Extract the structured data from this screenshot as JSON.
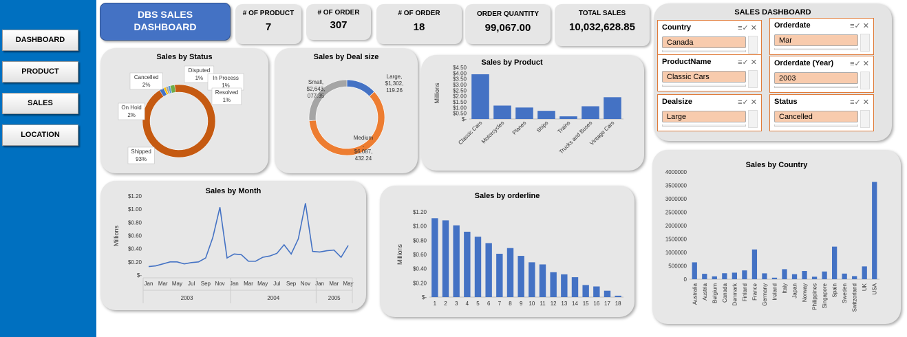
{
  "sidebar": {
    "buttons": [
      {
        "label": "DASHBOARD"
      },
      {
        "label": "PRODUCT"
      },
      {
        "label": "SALES"
      },
      {
        "label": "LOCATION"
      }
    ]
  },
  "header": {
    "title_line1": "DBS SALES",
    "title_line2": "DASHBOARD"
  },
  "kpis": [
    {
      "label": "# OF PRODUCT",
      "value": "7"
    },
    {
      "label": "# OF ORDER",
      "value": "307"
    },
    {
      "label": "# OF ORDER",
      "value": "18"
    },
    {
      "label": "ORDER QUANTITY",
      "value": "99,067.00"
    },
    {
      "label": "TOTAL SALES",
      "value": "10,032,628.85"
    }
  ],
  "filters": {
    "title": "SALES DASHBOARD",
    "slicers": [
      {
        "header": "Country",
        "value": "Canada"
      },
      {
        "header": "Orderdate",
        "value": "Mar"
      },
      {
        "header": "ProductName",
        "value": "Classic Cars"
      },
      {
        "header": "Orderdate (Year)",
        "value": "2003"
      },
      {
        "header": "Dealsize",
        "value": "Large"
      },
      {
        "header": "Status",
        "value": "Cancelled"
      }
    ]
  },
  "colors": {
    "accent_blue": "#4472c4",
    "sidebar": "#0070c0",
    "status_ring": "#c55a11",
    "deal_medium": "#ed7d31",
    "deal_small": "#a5a5a5",
    "slicer_selected": "#f8cbad",
    "slicer_border": "#e07b39"
  },
  "chart_data": [
    {
      "type": "pie",
      "title": "Sales by Status",
      "donut": true,
      "labels": [
        "Shipped",
        "Cancelled",
        "Disputed",
        "In Process",
        "Resolved",
        "On Hold"
      ],
      "values": [
        93,
        2,
        1,
        1,
        1,
        2
      ],
      "data_labels": [
        {
          "name": "Cancelled",
          "pct": "2%"
        },
        {
          "name": "Disputed",
          "pct": "1%"
        },
        {
          "name": "In Process",
          "pct": "1%"
        },
        {
          "name": "Resolved",
          "pct": "1%"
        },
        {
          "name": "On Hold",
          "pct": "2%"
        },
        {
          "name": "Shipped",
          "pct": "93%"
        }
      ]
    },
    {
      "type": "pie",
      "title": "Sales by Deal size",
      "donut": true,
      "labels": [
        "Large",
        "Medium",
        "Small"
      ],
      "values": [
        1302119.26,
        6087432.24,
        2643077.35
      ],
      "data_labels": [
        {
          "name": "Large",
          "value": "$1,302, 119.26"
        },
        {
          "name": "Medium",
          "value": "$6,087, 432.24"
        },
        {
          "name": "Small",
          "value": "$2,643, 077.35"
        }
      ]
    },
    {
      "type": "bar",
      "title": "Sales by Product",
      "ylabel": "Millions",
      "categories": [
        "Classic Cars",
        "Motorcycles",
        "Planes",
        "Ships",
        "Trains",
        "Trucks and Buses",
        "Vintage Cars"
      ],
      "values": [
        3.9,
        1.17,
        1.0,
        0.71,
        0.23,
        1.11,
        1.9
      ],
      "ylim": [
        0,
        4.5
      ],
      "yticks": [
        "$-",
        "$0.50",
        "$1.00",
        "$1.50",
        "$2.00",
        "$2.50",
        "$3.00",
        "$3.50",
        "$4.00",
        "$4.50"
      ]
    },
    {
      "type": "line",
      "title": "Sales by Month",
      "ylabel": "Millions",
      "x": [
        "Jan",
        "Feb",
        "Mar",
        "Apr",
        "May",
        "Jun",
        "Jul",
        "Aug",
        "Sep",
        "Oct",
        "Nov",
        "Dec",
        "Jan",
        "Feb",
        "Mar",
        "Apr",
        "May",
        "Jun",
        "Jul",
        "Aug",
        "Sep",
        "Oct",
        "Nov",
        "Dec",
        "Jan",
        "Feb",
        "Mar",
        "Apr",
        "May"
      ],
      "xtick_labels": [
        "Jan",
        "Mar",
        "May",
        "Jul",
        "Sep",
        "Nov",
        "Jan",
        "Mar",
        "May",
        "Jul",
        "Sep",
        "Nov",
        "Jan",
        "Mar",
        "May"
      ],
      "years": [
        "2003",
        "2004",
        "2005"
      ],
      "values": [
        0.13,
        0.14,
        0.17,
        0.2,
        0.2,
        0.17,
        0.19,
        0.2,
        0.26,
        0.57,
        1.03,
        0.26,
        0.32,
        0.31,
        0.21,
        0.21,
        0.27,
        0.29,
        0.33,
        0.46,
        0.32,
        0.55,
        1.09,
        0.36,
        0.35,
        0.37,
        0.38,
        0.27,
        0.45
      ],
      "ylim": [
        0,
        1.2
      ],
      "yticks": [
        "$-",
        "$0.20",
        "$0.40",
        "$0.60",
        "$0.80",
        "$1.00",
        "$1.20"
      ]
    },
    {
      "type": "bar",
      "title": "Sales by orderline",
      "ylabel": "Millions",
      "categories": [
        "1",
        "2",
        "3",
        "4",
        "5",
        "6",
        "7",
        "8",
        "9",
        "10",
        "11",
        "12",
        "13",
        "14",
        "15",
        "16",
        "17",
        "18"
      ],
      "values": [
        1.11,
        1.08,
        1.01,
        0.92,
        0.85,
        0.76,
        0.61,
        0.69,
        0.58,
        0.49,
        0.46,
        0.35,
        0.32,
        0.28,
        0.17,
        0.15,
        0.09,
        0.02
      ],
      "ylim": [
        0,
        1.2
      ],
      "yticks": [
        "$-",
        "$0.20",
        "$0.40",
        "$0.60",
        "$0.80",
        "$1.00",
        "$1.20"
      ]
    },
    {
      "type": "bar",
      "title": "Sales by Country",
      "categories": [
        "Australia",
        "Austria",
        "Belgium",
        "Canada",
        "Denmark",
        "Finland",
        "France",
        "Germany",
        "Ireland",
        "Italy",
        "Japan",
        "Norway",
        "Philippines",
        "Singapore",
        "Spain",
        "Sweden",
        "Switzerland",
        "UK",
        "USA"
      ],
      "values": [
        630000,
        202000,
        108000,
        224000,
        245000,
        329000,
        1110000,
        220000,
        57000,
        374000,
        188000,
        307000,
        94000,
        288000,
        1215000,
        210000,
        117000,
        478000,
        3627000
      ],
      "ylim": [
        0,
        4000000
      ],
      "yticks": [
        "0",
        "500000",
        "1000000",
        "1500000",
        "2000000",
        "2500000",
        "3000000",
        "3500000",
        "4000000"
      ]
    }
  ]
}
